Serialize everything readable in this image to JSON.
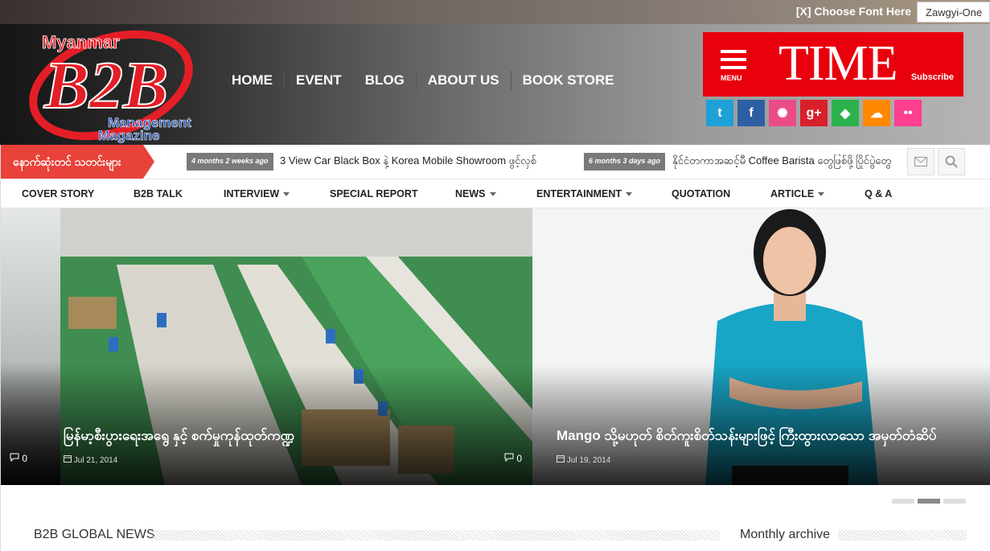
{
  "topbar": {
    "font_choose": "[X] Choose Font Here",
    "font_selected": "Zawgyi-One"
  },
  "logo": {
    "line1": "Myanmar",
    "mark": "B2B",
    "line2": "Management",
    "line3": "Magazine"
  },
  "nav": {
    "items": [
      "HOME",
      "EVENT",
      "BLOG",
      "ABOUT US",
      "BOOK STORE"
    ]
  },
  "ad": {
    "menu": "MENU",
    "brand": "TIME",
    "subscribe": "Subscribe"
  },
  "social": {
    "icons": [
      {
        "name": "twitter-icon",
        "glyph": "t",
        "color": "#1da1d6"
      },
      {
        "name": "facebook-icon",
        "glyph": "f",
        "color": "#2f5fa3"
      },
      {
        "name": "dribbble-icon",
        "glyph": "✺",
        "color": "#ea4c89"
      },
      {
        "name": "google-plus-icon",
        "glyph": "g+",
        "color": "#d81f2a"
      },
      {
        "name": "feedly-icon",
        "glyph": "◆",
        "color": "#2bb24c"
      },
      {
        "name": "soundcloud-icon",
        "glyph": "☁",
        "color": "#ff8800"
      },
      {
        "name": "flickr-icon",
        "glyph": "••",
        "color": "#ff3f8f"
      }
    ]
  },
  "ticker": {
    "label": "နောက်ဆုံးတင် သတင်းများ",
    "items": [
      {
        "time": "4 months 2 weeks ago",
        "text": "3 View Car Black Box နဲ့ Korea Mobile Showroom ဖွင့်လှစ်"
      },
      {
        "time": "6 months 3 days ago",
        "text": "နိုင်ငံတကာအဆင့်မီ Coffee Barista တွေဖြစ်ဖို့ ပြိုင်ပွဲတွေ"
      }
    ]
  },
  "categories": {
    "items": [
      {
        "label": "COVER STORY",
        "dropdown": false
      },
      {
        "label": "B2B TALK",
        "dropdown": false
      },
      {
        "label": "INTERVIEW",
        "dropdown": true
      },
      {
        "label": "SPECIAL REPORT",
        "dropdown": false
      },
      {
        "label": "NEWS",
        "dropdown": true
      },
      {
        "label": "ENTERTAINMENT",
        "dropdown": true
      },
      {
        "label": "QUOTATION",
        "dropdown": false
      },
      {
        "label": "ARTICLE",
        "dropdown": true
      },
      {
        "label": "Q & A",
        "dropdown": false
      }
    ]
  },
  "slider": {
    "left_comments": "0",
    "slides": [
      {
        "title": "မြန်မာ့စီးပွားရေးအရွေ နှင့် စက်မှုကုန်ထုတ်ကဏ္ဍ",
        "date": "Jul 21, 2014",
        "comments": "0"
      },
      {
        "title": "Mango သို့မဟုတ် စိတ်ကူးစိတ်သန်းများဖြင့် ကြီးထွားလာသော အမှတ်တံဆိပ်",
        "date": "Jul 19, 2014"
      }
    ],
    "active_index": 1,
    "dot_count": 3
  },
  "sections": {
    "global_news": "B2B GLOBAL NEWS",
    "monthly_archive": "Monthly archive"
  },
  "colors": {
    "accent_red": "#e8423a",
    "time_red": "#e8000c"
  }
}
